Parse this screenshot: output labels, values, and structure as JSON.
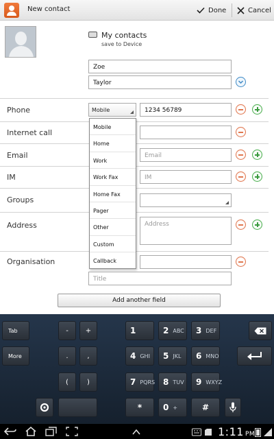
{
  "actionbar": {
    "title": "New contact",
    "done_label": "Done",
    "cancel_label": "Cancel"
  },
  "account": {
    "name": "My contacts",
    "subtitle": "save to Device"
  },
  "name": {
    "first": "Zoe",
    "last": "Taylor"
  },
  "labels": {
    "phone": "Phone",
    "internet_call": "Internet call",
    "email": "Email",
    "im": "IM",
    "groups": "Groups",
    "address": "Address",
    "organisation": "Organisation"
  },
  "phone": {
    "type": "Mobile",
    "number": "1234 56789"
  },
  "placeholders": {
    "email": "Email",
    "im": "IM",
    "address": "Address",
    "title": "Title"
  },
  "phone_type_options": [
    "Mobile",
    "Home",
    "Work",
    "Work Fax",
    "Home Fax",
    "Pager",
    "Other",
    "Custom",
    "Callback"
  ],
  "add_field_label": "Add another field",
  "keyboard": {
    "tab": "Tab",
    "more": "More",
    "minus": "-",
    "plus": "+",
    "dot": ".",
    "comma": ",",
    "lparen": "(",
    "rparen": ")",
    "k1": "1",
    "k2": "2",
    "k2s": "ABC",
    "k3": "3",
    "k3s": "DEF",
    "k4": "4",
    "k4s": "GHI",
    "k5": "5",
    "k5s": "JKL",
    "k6": "6",
    "k6s": "MNO",
    "k7": "7",
    "k7s": "PQRS",
    "k8": "8",
    "k8s": "TUV",
    "k9": "9",
    "k9s": "WXYZ",
    "kstar": "*",
    "k0": "0",
    "k0s": "+",
    "khash": "#"
  },
  "status": {
    "time": "1:11",
    "ampm": "PM"
  }
}
